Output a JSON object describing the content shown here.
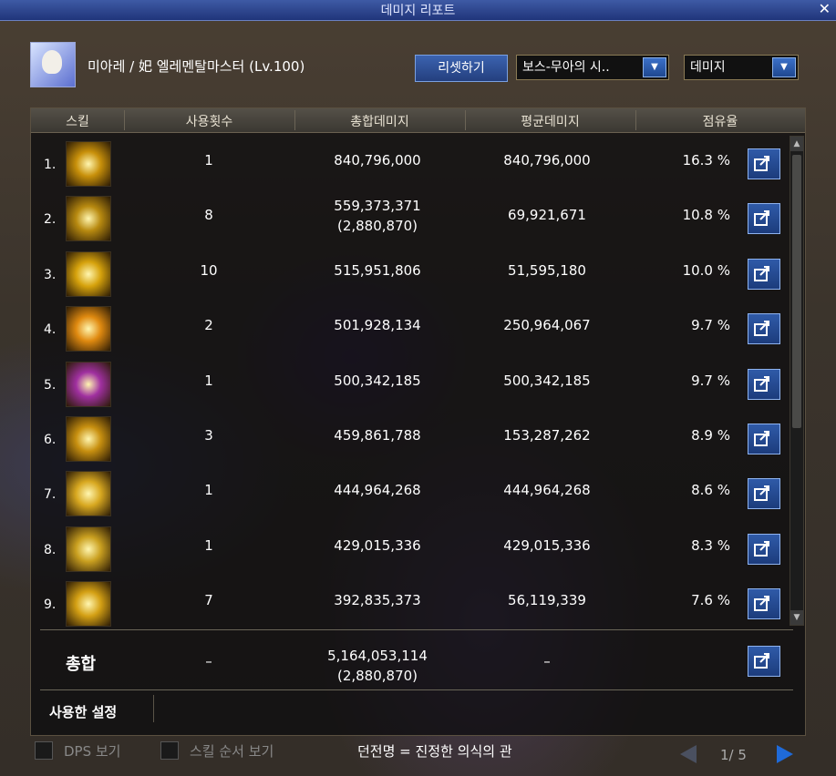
{
  "window": {
    "title": "데미지 리포트",
    "close_label": "✕"
  },
  "character": {
    "name": "미아레 / 𡚱 엘레멘탈마스터 (Lv.100)"
  },
  "controls": {
    "reset_label": "리셋하기",
    "boss_select": "보스-무아의 시..",
    "metric_select": "데미지"
  },
  "table": {
    "headers": [
      "스킬",
      "사용횟수",
      "총합데미지",
      "평균데미지",
      "점유율"
    ],
    "rows": [
      {
        "rank": "1.",
        "count": "1",
        "total": "840,796,000",
        "total_sub": "",
        "avg": "840,796,000",
        "share": "16.3 %",
        "icon": "lightning-pillar-icon",
        "color": "#c8900a"
      },
      {
        "rank": "2.",
        "count": "8",
        "total": "559,373,371",
        "total_sub": "(2,880,870)",
        "avg": "69,921,671",
        "share": "10.8 %",
        "icon": "cross-slash-icon",
        "color": "#b88a10"
      },
      {
        "rank": "3.",
        "count": "10",
        "total": "515,951,806",
        "total_sub": "",
        "avg": "51,595,180",
        "share": "10.0 %",
        "icon": "lightning-columns-icon",
        "color": "#d6a20c"
      },
      {
        "rank": "4.",
        "count": "2",
        "total": "501,928,134",
        "total_sub": "",
        "avg": "250,964,067",
        "share": "9.7 %",
        "icon": "starburst-icon",
        "color": "#e08a10"
      },
      {
        "rank": "5.",
        "count": "1",
        "total": "500,342,185",
        "total_sub": "",
        "avg": "500,342,185",
        "share": "9.7 %",
        "icon": "purple-dome-icon",
        "color": "#a030a0"
      },
      {
        "rank": "6.",
        "count": "3",
        "total": "459,861,788",
        "total_sub": "",
        "avg": "153,287,262",
        "share": "8.9 %",
        "icon": "halo-flare-icon",
        "color": "#c89010"
      },
      {
        "rank": "7.",
        "count": "1",
        "total": "444,964,268",
        "total_sub": "",
        "avg": "444,964,268",
        "share": "8.6 %",
        "icon": "burst-star-icon",
        "color": "#d8a820"
      },
      {
        "rank": "8.",
        "count": "1",
        "total": "429,015,336",
        "total_sub": "",
        "avg": "429,015,336",
        "share": "8.3 %",
        "icon": "black-sphere-icon",
        "color": "#caa020"
      },
      {
        "rank": "9.",
        "count": "7",
        "total": "392,835,373",
        "total_sub": "",
        "avg": "56,119,339",
        "share": "7.6 %",
        "icon": "crystal-cluster-icon",
        "color": "#d4a014"
      }
    ],
    "total": {
      "label": "총합",
      "count": "–",
      "total": "5,164,053,114",
      "total_sub": "(2,880,870)",
      "avg": "–"
    },
    "used_settings_label": "사용한 설정"
  },
  "footer": {
    "dps_view_label": "DPS 보기",
    "skill_order_label": "스킬 순서 보기",
    "dungeon_text": "던전명 = 진정한 의식의 관",
    "page": "1/ 5"
  }
}
